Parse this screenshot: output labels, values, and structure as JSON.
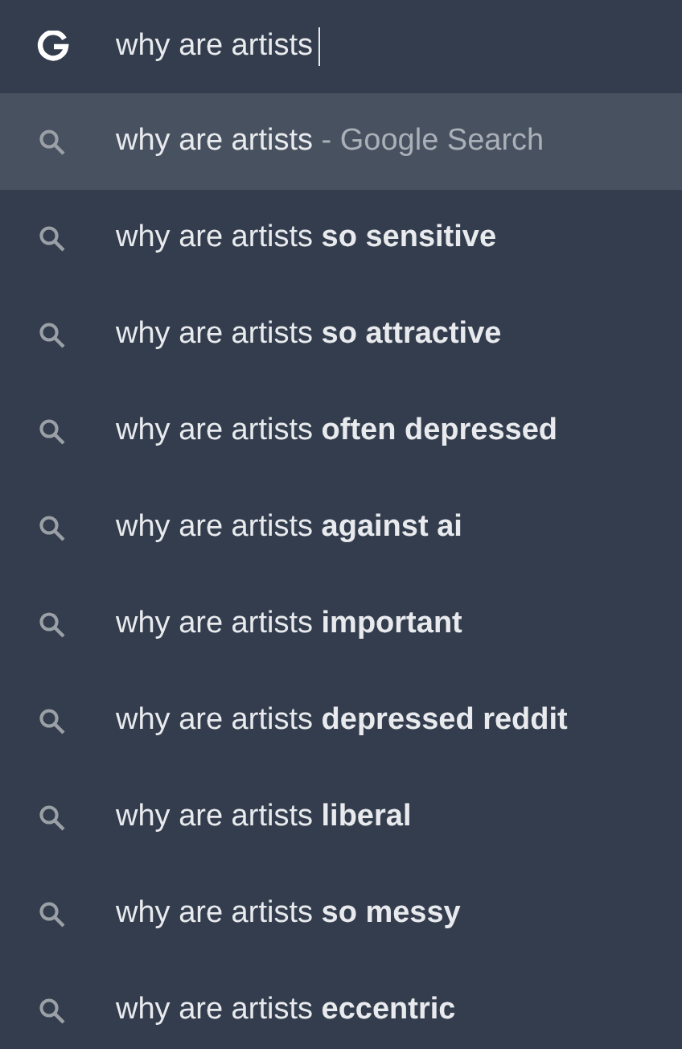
{
  "omnibox": {
    "value": "why are artists"
  },
  "suggestions": [
    {
      "kind": "search",
      "text": "why are artists",
      "suffix": "- Google Search",
      "selected": true
    },
    {
      "kind": "suggestion",
      "text": "why are artists **so sensitive**",
      "selected": false
    },
    {
      "kind": "suggestion",
      "text": "why are artists **so attractive**",
      "selected": false
    },
    {
      "kind": "suggestion",
      "text": "why are artists **often depressed**",
      "selected": false
    },
    {
      "kind": "suggestion",
      "text": "why are artists **against ai**",
      "selected": false
    },
    {
      "kind": "suggestion",
      "text": "why are artists **important**",
      "selected": false
    },
    {
      "kind": "suggestion",
      "text": "why are artists **depressed reddit**",
      "selected": false
    },
    {
      "kind": "suggestion",
      "text": "why are artists **liberal**",
      "selected": false
    },
    {
      "kind": "suggestion",
      "text": "why are artists **so messy**",
      "selected": false
    },
    {
      "kind": "suggestion",
      "text": "why are artists **eccentric**",
      "selected": false
    }
  ]
}
